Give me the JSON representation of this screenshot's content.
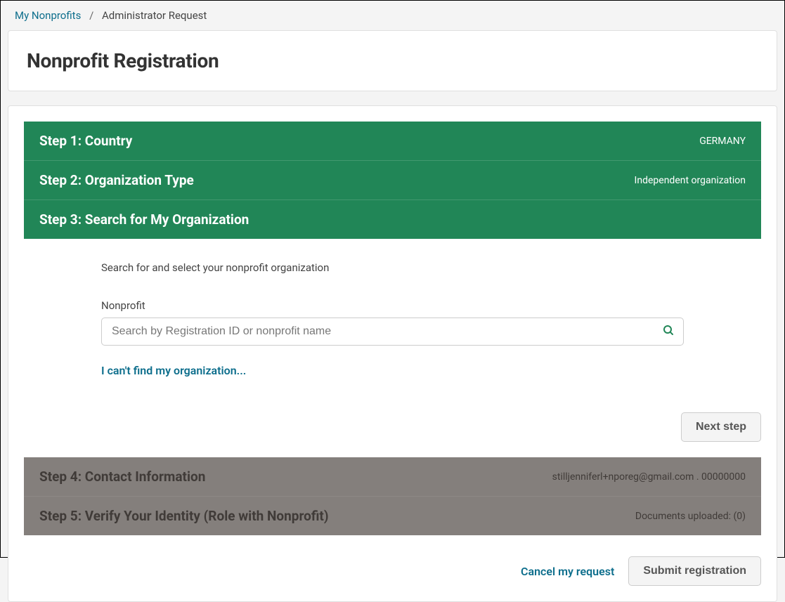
{
  "breadcrumb": {
    "root_label": "My Nonprofits",
    "current_label": "Administrator Request"
  },
  "page_title": "Nonprofit Registration",
  "steps": {
    "s1": {
      "title": "Step 1: Country",
      "value": "GERMANY"
    },
    "s2": {
      "title": "Step 2: Organization Type",
      "value": "Independent organization"
    },
    "s3": {
      "title": "Step 3: Search for My Organization"
    },
    "s4": {
      "title": "Step 4: Contact Information",
      "value": "stilljenniferl+nporeg@gmail.com . 00000000"
    },
    "s5": {
      "title": "Step 5: Verify Your Identity (Role with Nonprofit)",
      "value": "Documents uploaded: (0)"
    }
  },
  "search_section": {
    "description": "Search for and select your nonprofit organization",
    "field_label": "Nonprofit",
    "placeholder": "Search by Registration ID or nonprofit name",
    "cant_find_link": "I can't find my organization..."
  },
  "buttons": {
    "next": "Next step",
    "cancel": "Cancel my request",
    "submit": "Submit registration"
  }
}
